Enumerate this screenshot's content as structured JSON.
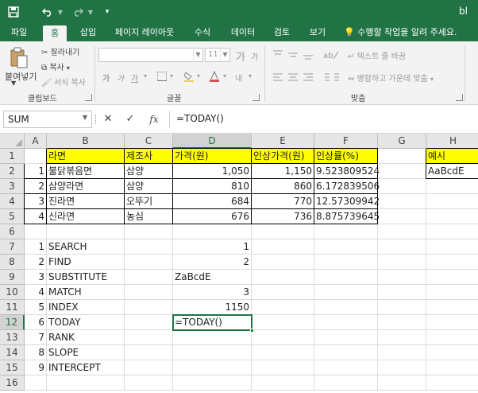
{
  "title_bar": {
    "save_icon": "save-icon",
    "undo_icon": "undo-icon",
    "redo_icon": "redo-icon",
    "title": "bl"
  },
  "tabs": [
    "파일",
    "홈",
    "삽입",
    "페이지 레이아웃",
    "수식",
    "데이터",
    "검토",
    "보기"
  ],
  "active_tab": "홈",
  "tell_me": "수행할 작업을 알려 주세요.",
  "ribbon": {
    "paste_label": "붙여넣기",
    "cut_label": "잘라내기",
    "copy_label": "복사",
    "format_painter_label": "서식 복사",
    "clipboard_group": "클립보드",
    "font_size": "11",
    "bold": "가",
    "italic": "가",
    "underline": "가",
    "grow_font": "가",
    "shrink_font": "가",
    "font_color_icon": "내",
    "font_group": "글꼴",
    "wrap_text": "텍스트 줄 바꿈",
    "merge_center": "병합하고 가운데 맞춤",
    "alignment_group": "맞춤"
  },
  "formula_bar": {
    "name_box": "SUM",
    "cancel_icon": "✕",
    "enter_icon": "✓",
    "function_icon": "fx",
    "formula": "=TODAY()"
  },
  "columns": [
    "A",
    "B",
    "C",
    "D",
    "E",
    "F",
    "G",
    "H"
  ],
  "rows": [
    "1",
    "2",
    "3",
    "4",
    "5",
    "6",
    "7",
    "8",
    "9",
    "10",
    "11",
    "12",
    "13",
    "14",
    "15",
    "16"
  ],
  "active_column": "D",
  "active_row": "12",
  "sheet": {
    "header": [
      "라면",
      "제조사",
      "가격(원)",
      "인상가격(원)",
      "인상률(%)"
    ],
    "rows": [
      [
        "1",
        "불닭볶음면",
        "삼양",
        "1,050",
        "1,150",
        "9.523809524"
      ],
      [
        "2",
        "삼양라면",
        "삼양",
        "810",
        "860",
        "6.172839506"
      ],
      [
        "3",
        "진라면",
        "오뚜기",
        "684",
        "770",
        "12.57309942"
      ],
      [
        "4",
        "신라면",
        "농심",
        "676",
        "736",
        "8.875739645"
      ]
    ],
    "example_header": "예시",
    "example_value": "AaBcdE",
    "functions": [
      [
        "1",
        "SEARCH",
        "1"
      ],
      [
        "2",
        "FIND",
        "2"
      ],
      [
        "3",
        "SUBSTITUTE",
        "ZaBcdE"
      ],
      [
        "4",
        "MATCH",
        "3"
      ],
      [
        "5",
        "INDEX",
        "1150"
      ],
      [
        "6",
        "TODAY",
        "=TODAY()"
      ],
      [
        "7",
        "RANK",
        ""
      ],
      [
        "8",
        "SLOPE",
        ""
      ],
      [
        "9",
        "INTERCEPT",
        ""
      ]
    ]
  },
  "colors": {
    "excel_green": "#217346",
    "highlight_yellow": "#ffff00",
    "header_gray": "#e6e6e6"
  }
}
